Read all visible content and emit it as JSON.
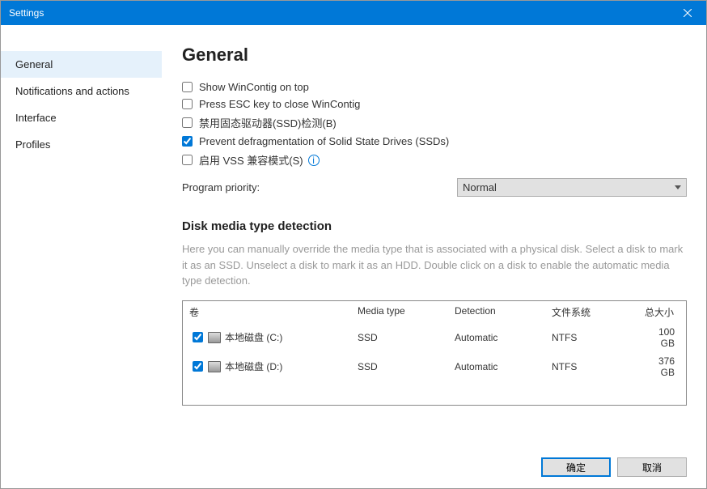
{
  "window": {
    "title": "Settings"
  },
  "sidebar": {
    "items": [
      {
        "label": "General"
      },
      {
        "label": "Notifications and actions"
      },
      {
        "label": "Interface"
      },
      {
        "label": "Profiles"
      }
    ]
  },
  "main": {
    "heading": "General",
    "opts": {
      "on_top": "Show WinContig on top",
      "esc_close": "Press ESC key to close WinContig",
      "disable_ssd": "禁用固态驱动器(SSD)检测(B)",
      "prevent_defrag": "Prevent defragmentation of Solid State Drives (SSDs)",
      "vss_compat": "启用 VSS 兼容模式(S)"
    },
    "priority": {
      "label": "Program priority:",
      "value": "Normal"
    },
    "disk": {
      "heading": "Disk media type detection",
      "desc": "Here you can manually override the media type that is associated with a physical disk. Select a disk to mark it as an SSD. Unselect a disk to mark it as an HDD. Double click on a disk to enable the automatic media type detection.",
      "headers": {
        "vol": "卷",
        "media": "Media type",
        "detect": "Detection",
        "fs": "文件系统",
        "size": "总大小"
      },
      "rows": [
        {
          "checked": true,
          "name": "本地磁盘 (C:)",
          "media": "SSD",
          "detect": "Automatic",
          "fs": "NTFS",
          "size": "100 GB"
        },
        {
          "checked": true,
          "name": "本地磁盘 (D:)",
          "media": "SSD",
          "detect": "Automatic",
          "fs": "NTFS",
          "size": "376 GB"
        }
      ]
    }
  },
  "footer": {
    "ok": "确定",
    "cancel": "取消"
  }
}
